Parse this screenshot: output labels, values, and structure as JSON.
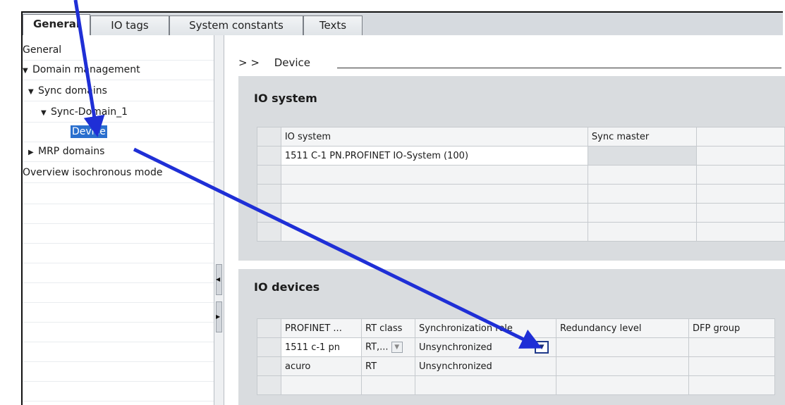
{
  "tabs": [
    {
      "label": "General",
      "active": true
    },
    {
      "label": "IO tags",
      "active": false
    },
    {
      "label": "System constants",
      "active": false
    },
    {
      "label": "Texts",
      "active": false
    }
  ],
  "tree": {
    "items": [
      {
        "label": "General",
        "level": 0,
        "expander": ""
      },
      {
        "label": "Domain management",
        "level": 0,
        "expander": "open"
      },
      {
        "label": "Sync domains",
        "level": 1,
        "expander": "open"
      },
      {
        "label": "Sync-Domain_1",
        "level": 2,
        "expander": "open"
      },
      {
        "label": "Device",
        "level": 3,
        "expander": "",
        "selected": true
      },
      {
        "label": "MRP domains",
        "level": 1,
        "expander": "closed"
      },
      {
        "label": "Overview isochronous mode",
        "level": 0,
        "expander": ""
      }
    ]
  },
  "breadcrumb": {
    "prefix": "> >",
    "text": "Device"
  },
  "io_system": {
    "title": "IO system",
    "columns": [
      "IO system",
      "Sync master"
    ],
    "rows": [
      [
        "1511 C-1 PN.PROFINET IO-System (100)",
        ""
      ]
    ]
  },
  "io_devices": {
    "title": "IO devices",
    "columns": [
      "PROFINET ...",
      "RT class",
      "Synchronization role",
      "Redundancy level",
      "DFP group"
    ],
    "rows": [
      {
        "device": "1511 c-1 pn",
        "rt_class": "RT,...",
        "sync_role": "Unsynchronized",
        "redundancy": "",
        "dfp": ""
      },
      {
        "device": "acuro",
        "rt_class": "RT",
        "sync_role": "Unsynchronized",
        "redundancy": "",
        "dfp": ""
      }
    ]
  },
  "colors": {
    "annotation_arrow": "#1f2fd6",
    "selection": "#2a6fce",
    "section_bg": "#d9dcdf"
  },
  "icons": {
    "expanded": "triangle-down-icon",
    "collapsed": "triangle-right-icon",
    "dropdown": "chevron-down-icon"
  }
}
